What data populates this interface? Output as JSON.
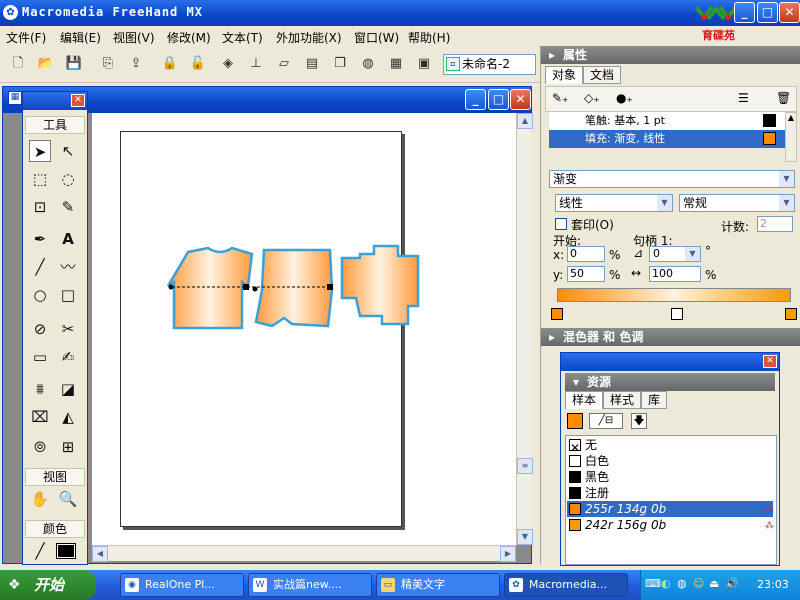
{
  "app": {
    "title": "Macromedia FreeHand MX"
  },
  "menu": [
    "文件(F)",
    "编辑(E)",
    "视图(V)",
    "修改(M)",
    "文本(T)",
    "外加功能(X)",
    "窗口(W)",
    "帮助(H)"
  ],
  "logo_text": "育碟苑",
  "toolbar": {
    "doc_name": "未命名-2"
  },
  "tools": {
    "title": "工具",
    "view_title": "视图",
    "color_title": "颜色"
  },
  "properties": {
    "title": "属性",
    "tabs": [
      "对象",
      "文档"
    ],
    "stroke": "笔触: 基本, 1 pt",
    "fill": "填充: 渐变, 线性",
    "fill_type": "渐变",
    "gradient_type": "线性",
    "mode": "常规",
    "overprint": "套印(O)",
    "count_label": "计数:",
    "count_value": "2",
    "start_label": "开始:",
    "handle_label": "句柄 1:",
    "x_label": "x:",
    "x_value": "0",
    "y_label": "y:",
    "y_value": "50",
    "pct": "%",
    "angle_value": "0",
    "deg": "°",
    "length_value": "100",
    "start_color": "#ff8c00",
    "end_color": "#f29c00"
  },
  "mixer": {
    "title": "混色器 和 色调"
  },
  "resources": {
    "title": "资源",
    "tabs": [
      "样本",
      "样式",
      "库"
    ],
    "items": [
      {
        "label": "无",
        "color": "#ffffff"
      },
      {
        "label": "白色",
        "color": "#ffffff"
      },
      {
        "label": "黑色",
        "color": "#000000"
      },
      {
        "label": "注册",
        "color": "#000000"
      },
      {
        "label": "255r 134g 0b",
        "color": "#ff8600"
      },
      {
        "label": "242r 156g 0b",
        "color": "#f29c00"
      }
    ]
  },
  "taskbar": {
    "start": "开始",
    "tasks": [
      "RealOne Pl...",
      "实战篇new....",
      "精美文字",
      "Macromedia..."
    ],
    "clock": "23:03"
  },
  "shapes": {
    "fill_start": "#ff9a3c",
    "fill_mid": "#fff2e0",
    "outline": "#3aa0d8"
  }
}
